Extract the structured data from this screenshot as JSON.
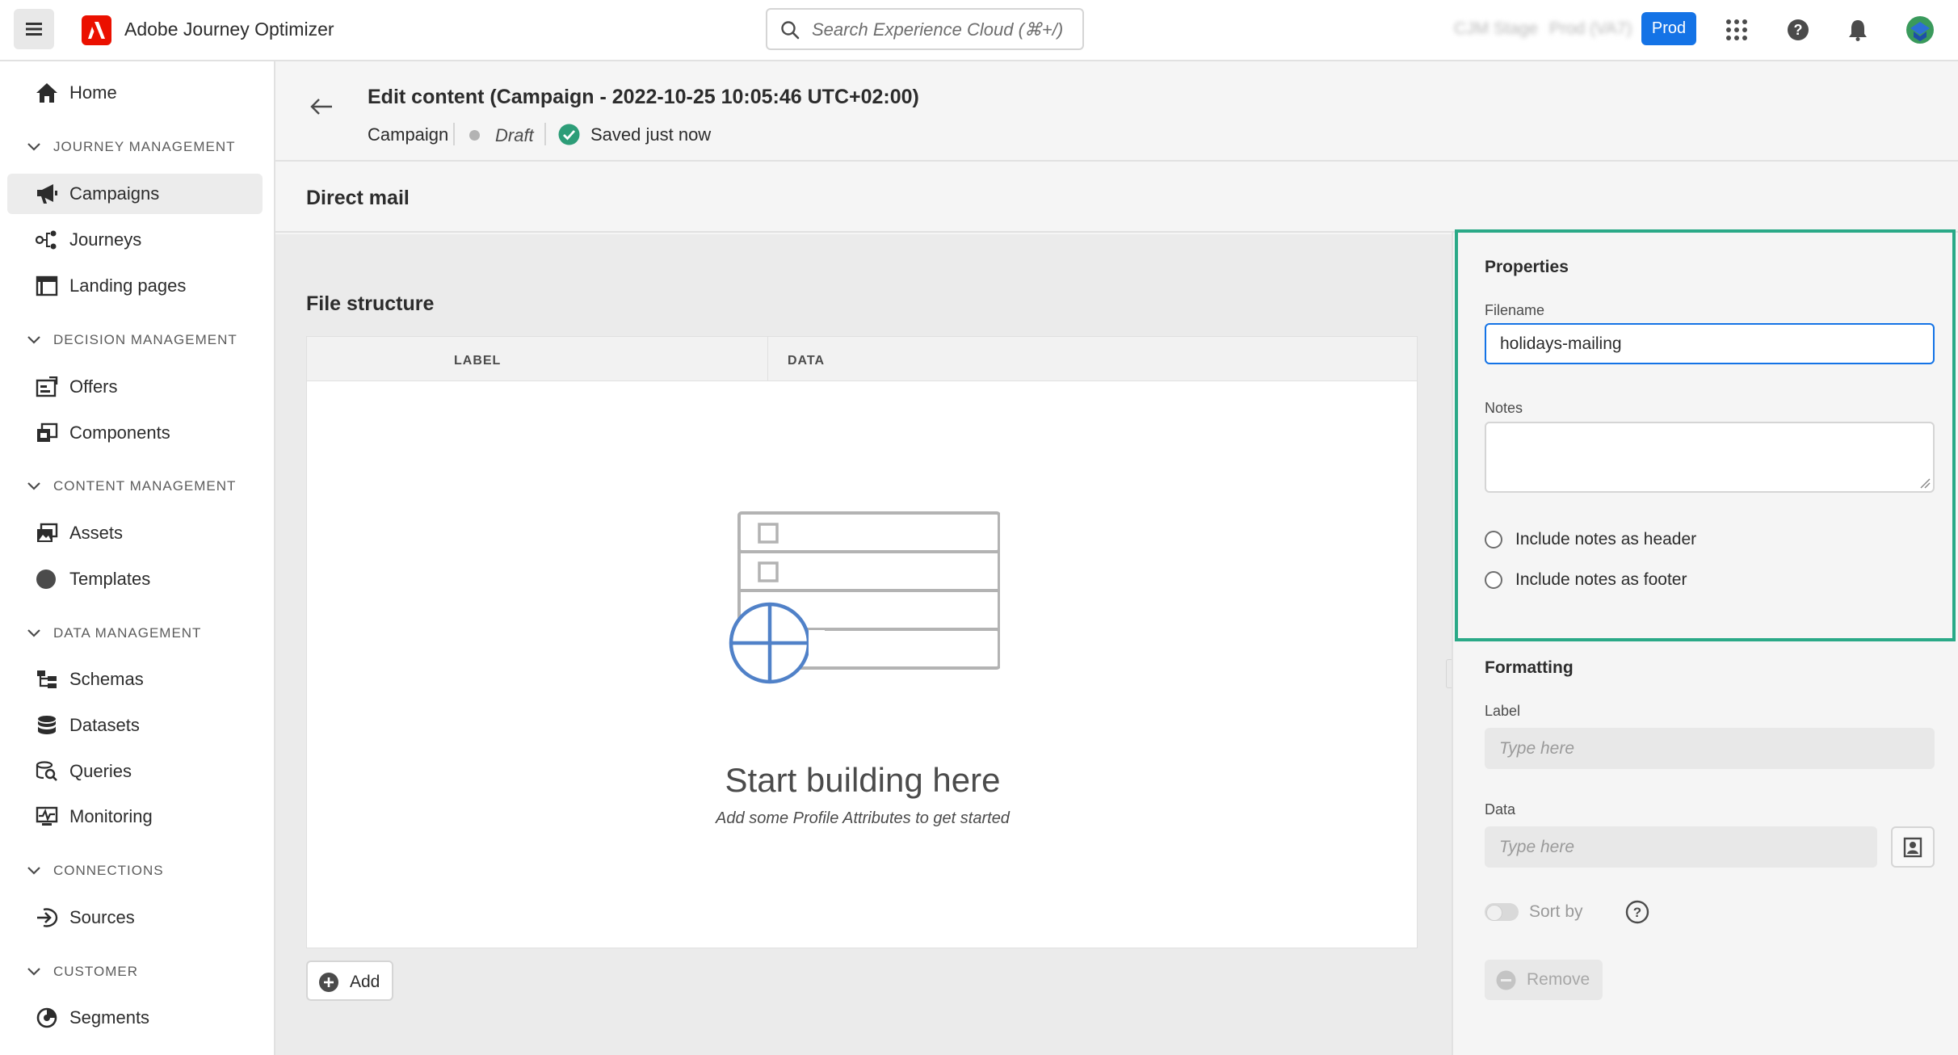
{
  "topbar": {
    "app_title": "Adobe Journey Optimizer",
    "search_placeholder": "Search Experience Cloud (⌘+/)",
    "org_name": "CJM Stage",
    "sandbox_name": "Prod (VA7)",
    "env_label": "Prod"
  },
  "sidebar": {
    "home": "Home",
    "journey_management": "JOURNEY MANAGEMENT",
    "campaigns": "Campaigns",
    "journeys": "Journeys",
    "landing_pages": "Landing pages",
    "decision_management": "DECISION MANAGEMENT",
    "offers": "Offers",
    "components": "Components",
    "content_management": "CONTENT MANAGEMENT",
    "assets": "Assets",
    "templates": "Templates",
    "data_management": "DATA MANAGEMENT",
    "schemas": "Schemas",
    "datasets": "Datasets",
    "queries": "Queries",
    "monitoring": "Monitoring",
    "connections": "CONNECTIONS",
    "sources": "Sources",
    "customer": "CUSTOMER",
    "segments": "Segments"
  },
  "header": {
    "title": "Edit content (Campaign - 2022-10-25 10:05:46 UTC+02:00)",
    "type": "Campaign",
    "status": "Draft",
    "saved": "Saved just now"
  },
  "section": {
    "title": "Direct mail"
  },
  "file_structure": {
    "title": "File structure",
    "col_label": "LABEL",
    "col_data": "DATA",
    "empty_title": "Start building here",
    "empty_sub": "Add some Profile Attributes to get started",
    "add_label": "Add"
  },
  "properties": {
    "title": "Properties",
    "filename_label": "Filename",
    "filename_value": "holidays-mailing",
    "notes_label": "Notes",
    "notes_header": "Include notes as header",
    "notes_footer": "Include notes as footer"
  },
  "formatting": {
    "title": "Formatting",
    "label_label": "Label",
    "label_placeholder": "Type here",
    "data_label": "Data",
    "data_placeholder": "Type here",
    "sort_by": "Sort by",
    "remove": "Remove"
  },
  "colors": {
    "accent": "#1473e6",
    "highlight": "#2aa987",
    "adobe_red": "#eb1000",
    "saved_green": "#2d9d78"
  }
}
